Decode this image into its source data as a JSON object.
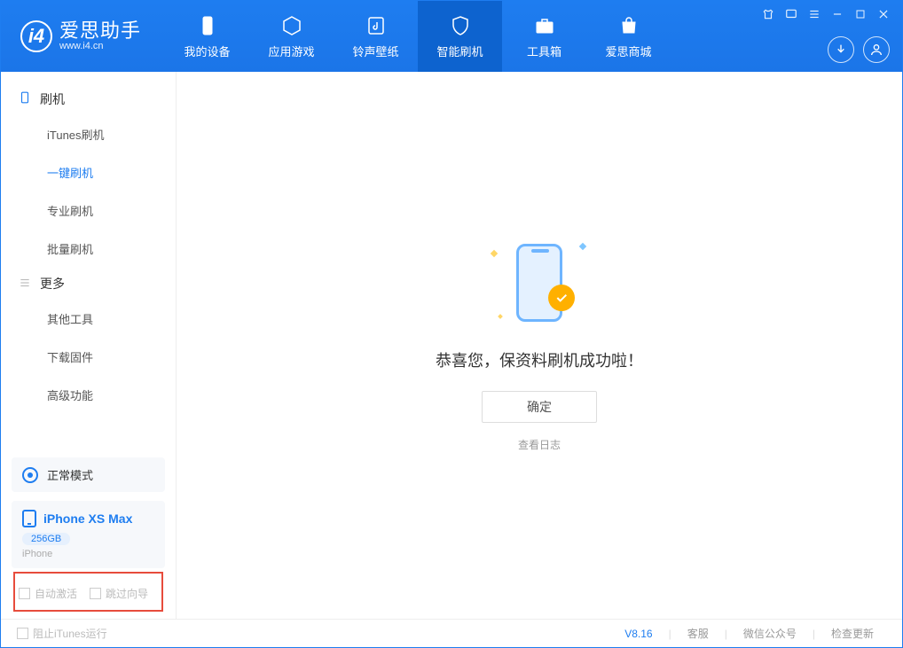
{
  "app": {
    "name": "爱思助手",
    "url": "www.i4.cn"
  },
  "nav": {
    "items": [
      {
        "label": "我的设备"
      },
      {
        "label": "应用游戏"
      },
      {
        "label": "铃声壁纸"
      },
      {
        "label": "智能刷机"
      },
      {
        "label": "工具箱"
      },
      {
        "label": "爱思商城"
      }
    ]
  },
  "sidebar": {
    "group1": {
      "title": "刷机",
      "items": [
        "iTunes刷机",
        "一键刷机",
        "专业刷机",
        "批量刷机"
      ]
    },
    "group2": {
      "title": "更多",
      "items": [
        "其他工具",
        "下载固件",
        "高级功能"
      ]
    },
    "mode": "正常模式",
    "device": {
      "name": "iPhone XS Max",
      "capacity": "256GB",
      "type": "iPhone"
    },
    "checks": {
      "auto_activate": "自动激活",
      "skip_guide": "跳过向导"
    }
  },
  "main": {
    "success_msg": "恭喜您，保资料刷机成功啦！",
    "ok": "确定",
    "log": "查看日志"
  },
  "footer": {
    "block_itunes": "阻止iTunes运行",
    "version": "V8.16",
    "links": [
      "客服",
      "微信公众号",
      "检查更新"
    ]
  }
}
